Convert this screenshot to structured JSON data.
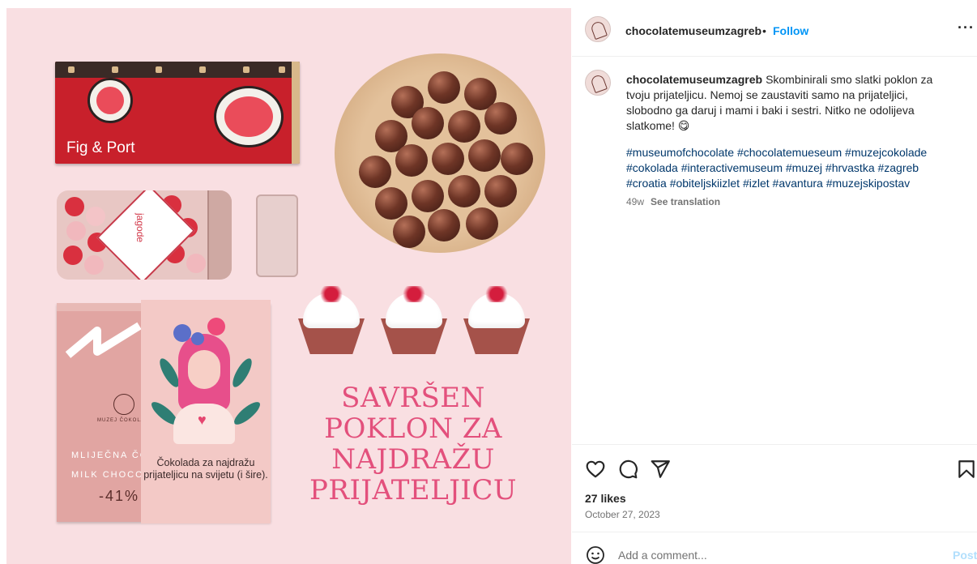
{
  "media": {
    "bar_label": "Fig & Port",
    "jar_label": "jagode",
    "box_texts": [
      "MLIJEČNA ČOK",
      "MILK CHOCO",
      "-41%"
    ],
    "box_logo": "MUZEJ ČOKOLADE",
    "sleeve_text": "Čokolada za najdražu prijateljicu na svijetu (i šire).",
    "headline_lines": [
      "SAVRŠEN",
      "POKLON ZA",
      "NAJDRAŽU",
      "PRIJATELJICU"
    ]
  },
  "header": {
    "username": "chocolatemuseumzagreb",
    "separator": "•",
    "follow_label": "Follow",
    "more_label": "···"
  },
  "caption": {
    "username": "chocolatemuseumzagreb",
    "text": "Skombinirali smo slatki poklon za tvoju prijateljicu. Nemoj se zaustaviti samo na prijateljici, slobodno ga daruj i mami i baki i sestri. Nitko ne odolijeva slatkome! 😋",
    "hashtags": "#museumofchocolate #chocolatemueseum #muzejcokolade #cokolada #interactivemuseum #muzej #hrvastka #zagreb #croatia #obiteljskiizlet #izlet #avantura #muzejskipostav",
    "age": "49w",
    "see_translation": "See translation"
  },
  "engagement": {
    "likes": "27 likes",
    "date": "October 27, 2023"
  },
  "comment": {
    "placeholder": "Add a comment...",
    "post_label": "Post"
  },
  "colors": {
    "media_bg": "#f9dfe2",
    "follow": "#0095f6",
    "hashtag": "#00376b",
    "headline": "#e3507c"
  }
}
